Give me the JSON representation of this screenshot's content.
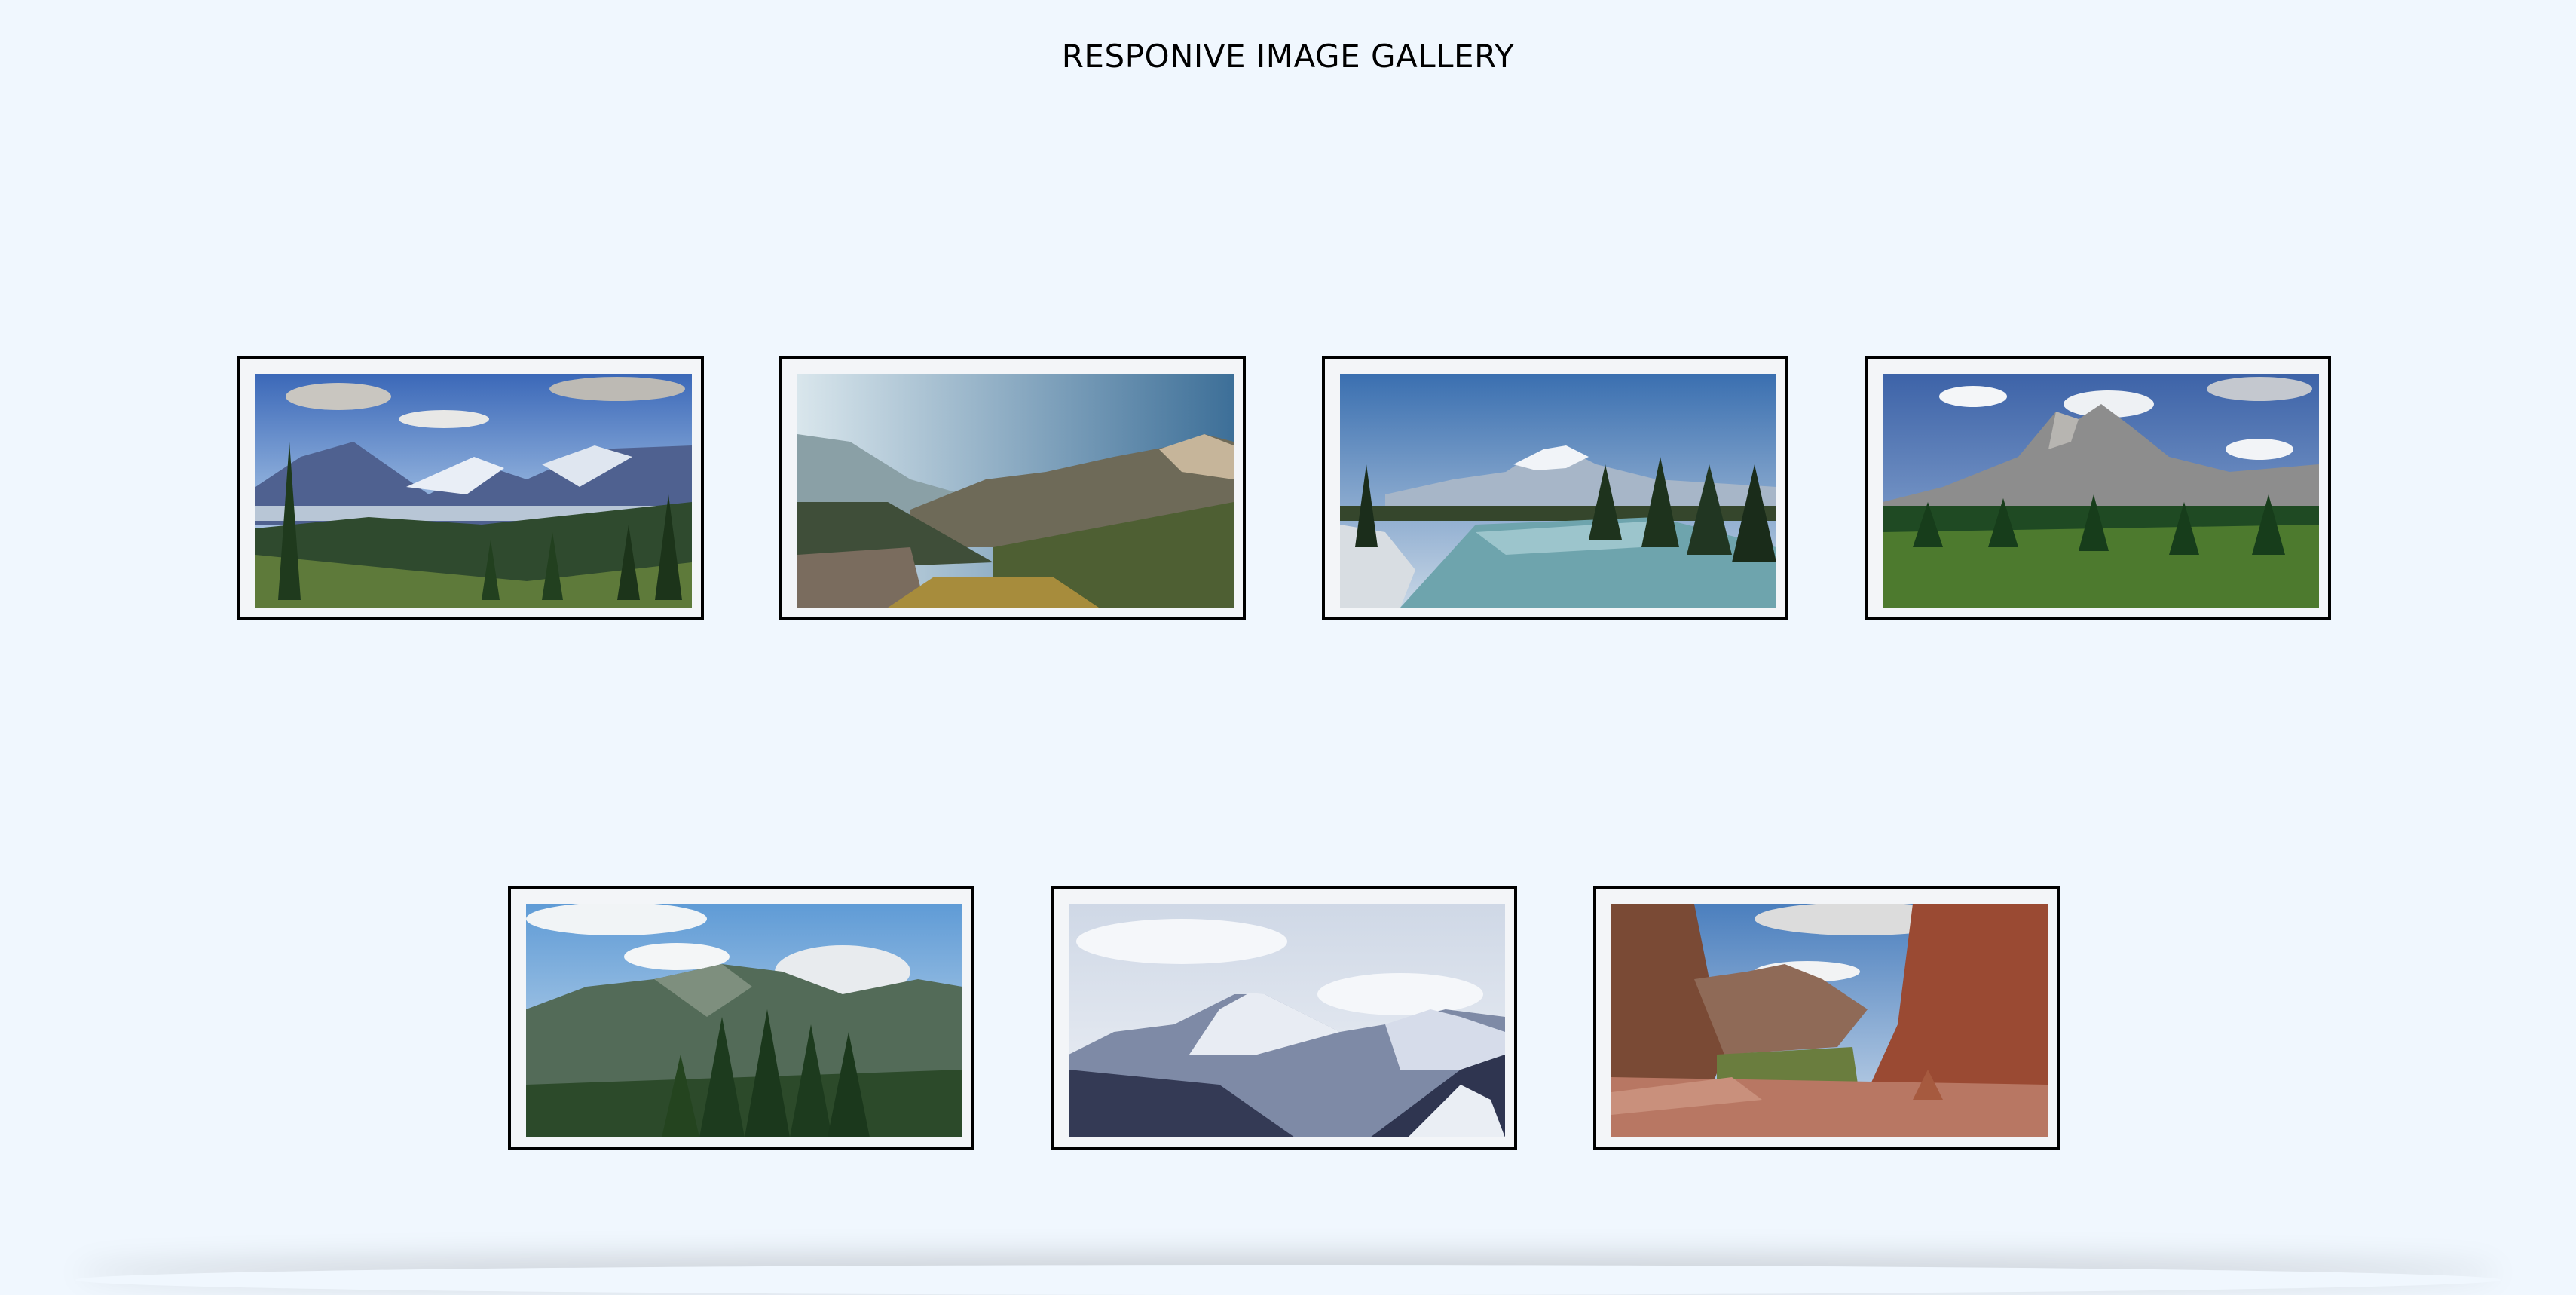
{
  "page": {
    "title": "RESPONIVE IMAGE GALLERY",
    "background": "#f0f7fe"
  },
  "gallery": {
    "items": [
      {
        "alt": "Mountain valley with evergreen forest"
      },
      {
        "alt": "Hazy mountain valley with rocky peaks"
      },
      {
        "alt": "River flowing toward a snowy mountain"
      },
      {
        "alt": "Rocky peak above a pine forest and meadow"
      },
      {
        "alt": "Forested mountain ridge under clouds"
      },
      {
        "alt": "Snow-covered mountain range"
      },
      {
        "alt": "Red rock canyon overlook"
      }
    ]
  }
}
